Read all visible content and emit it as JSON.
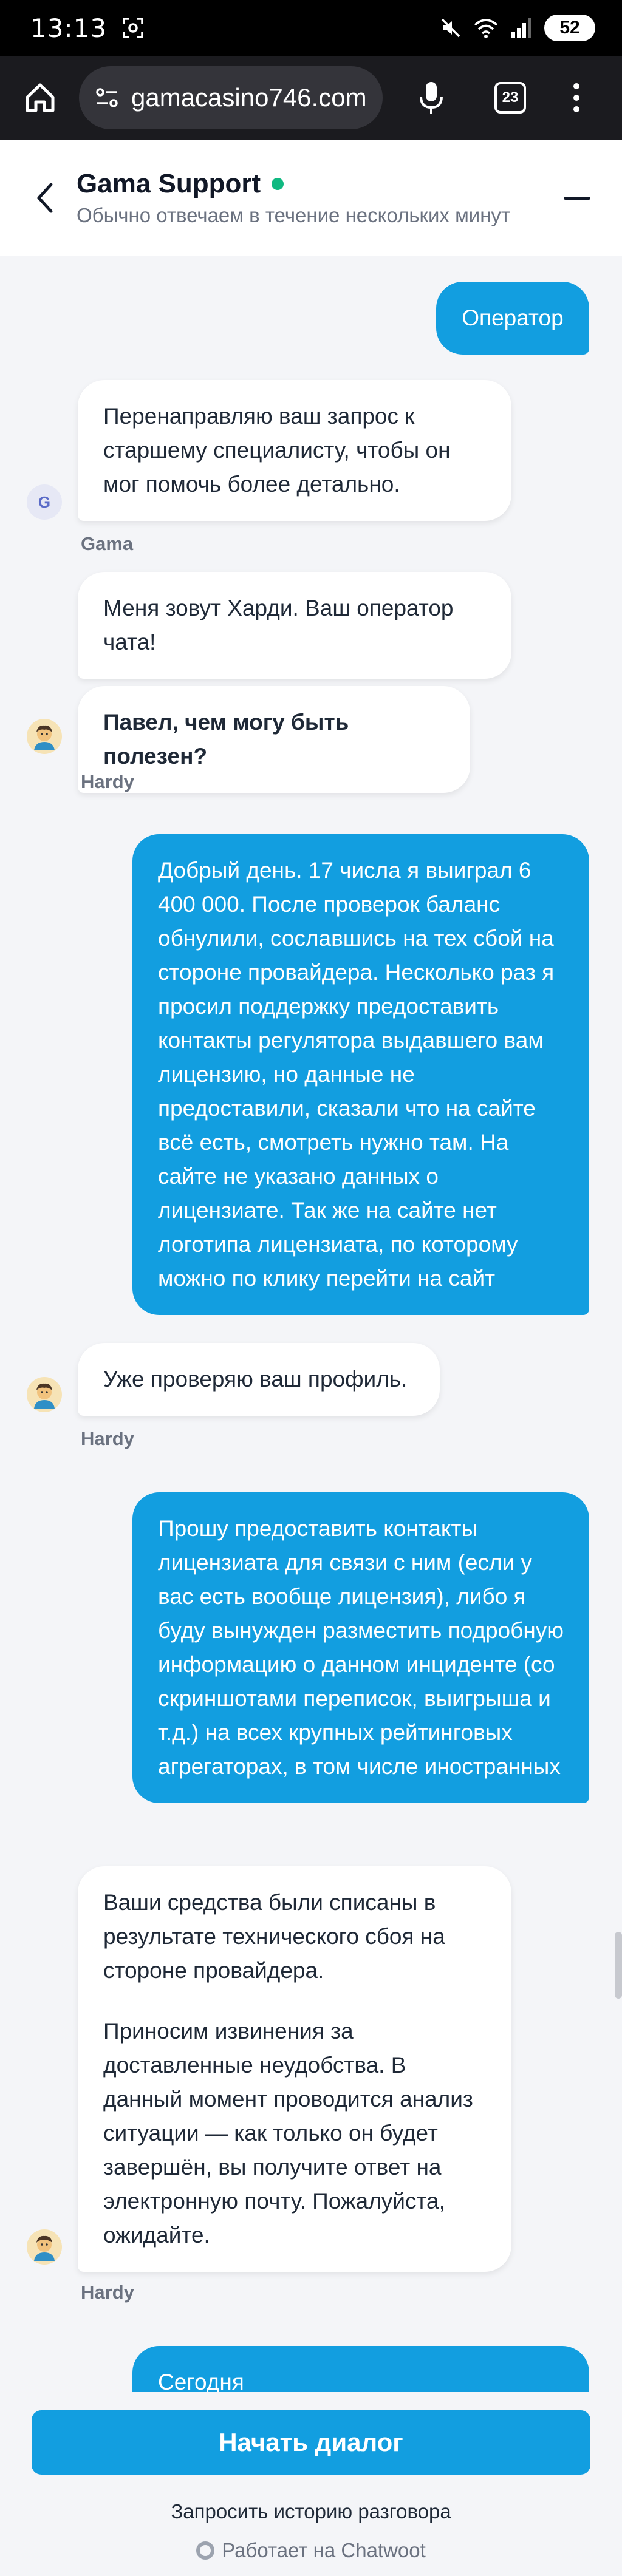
{
  "status_bar": {
    "time": "13:13",
    "battery": "52"
  },
  "browser": {
    "url": "gamacasino746.com",
    "tab_count": "23"
  },
  "header": {
    "title": "Gama Support",
    "subtitle": "Обычно отвечаем в течение нескольких минут"
  },
  "messages": {
    "m1": {
      "text": "Оператор"
    },
    "m2": {
      "text": "Перенаправляю ваш запрос к старшему специалисту, чтобы он мог помочь более детально.",
      "sender": "Gama",
      "avatar_letter": "G"
    },
    "m3": {
      "text": "Меня зовут Харди. Ваш оператор чата!"
    },
    "m4": {
      "text": "Павел, чем могу быть полезен?",
      "sender": "Hardy"
    },
    "m5": {
      "text": "Добрый день. 17 числа я выиграл 6 400 000. После проверок баланс обнулили, сославшись на тех сбой на стороне провайдера. Несколько раз я просил поддержку предоставить контакты регулятора выдавшего вам лицензию, но данные не предоставили, сказали что на сайте всё есть, смотреть нужно там. На сайте не указано данных о лицензиате. Так же на сайте нет логотипа лицензиата, по которому можно по клику перейти на сайт"
    },
    "m6": {
      "text": "Уже проверяю ваш профиль.",
      "sender": "Hardy"
    },
    "m7": {
      "text": "Прошу предоставить контакты лицензиата для связи с ним (если у вас есть вообще лицензия), либо я буду вынужден разместить подробную информацию о данном инциденте (со скриншотами переписок, выигрыша и т.д.) на всех крупных рейтинговых агрегаторах, в том числе иностранных"
    },
    "m8": {
      "p1": "Ваши средства были списаны в результате технического сбоя на стороне провайдера.",
      "p2": "Приносим извинения за доставленные неудобства. В данный момент проводится анализ ситуации — как только он будет завершён, вы получите ответ на электронную почту. Пожалуйста, ожидайте.",
      "sender": "Hardy"
    },
    "m9": {
      "text": "Сегодня"
    }
  },
  "footer": {
    "start_button": "Начать диалог",
    "history_link": "Запросить историю разговора",
    "powered_by": "Работает на Chatwoot"
  },
  "colors": {
    "accent": "#129ee0",
    "online": "#10b981"
  }
}
